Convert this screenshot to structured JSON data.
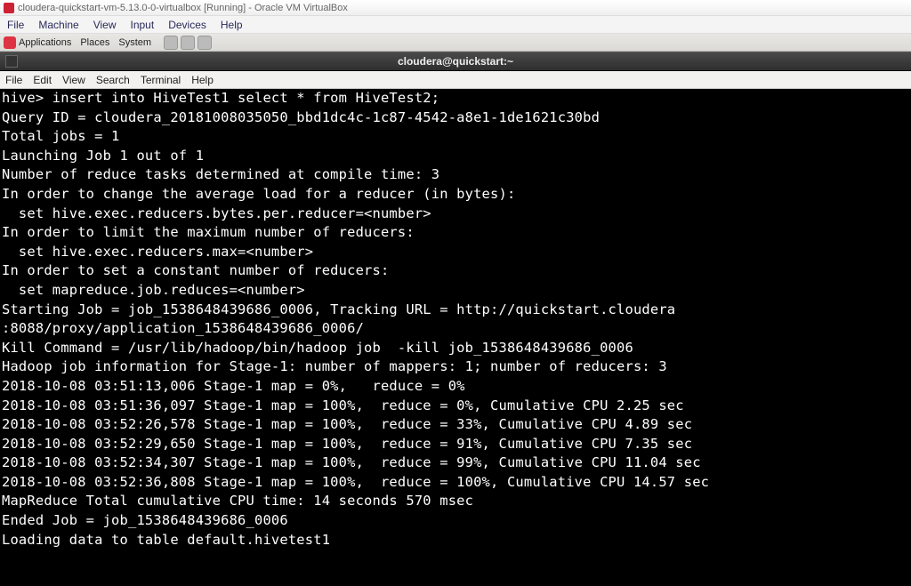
{
  "vbox": {
    "title": "cloudera-quickstart-vm-5.13.0-0-virtualbox [Running] - Oracle VM VirtualBox",
    "menu": [
      "File",
      "Machine",
      "View",
      "Input",
      "Devices",
      "Help"
    ]
  },
  "gnome": {
    "applications": "Applications",
    "places": "Places",
    "system": "System"
  },
  "terminal": {
    "title": "cloudera@quickstart:~",
    "menu": [
      "File",
      "Edit",
      "View",
      "Search",
      "Terminal",
      "Help"
    ],
    "lines": [
      "hive> insert into HiveTest1 select * from HiveTest2;",
      "Query ID = cloudera_20181008035050_bbd1dc4c-1c87-4542-a8e1-1de1621c30bd",
      "Total jobs = 1",
      "Launching Job 1 out of 1",
      "Number of reduce tasks determined at compile time: 3",
      "In order to change the average load for a reducer (in bytes):",
      "  set hive.exec.reducers.bytes.per.reducer=<number>",
      "In order to limit the maximum number of reducers:",
      "  set hive.exec.reducers.max=<number>",
      "In order to set a constant number of reducers:",
      "  set mapreduce.job.reduces=<number>",
      "Starting Job = job_1538648439686_0006, Tracking URL = http://quickstart.cloudera",
      ":8088/proxy/application_1538648439686_0006/",
      "Kill Command = /usr/lib/hadoop/bin/hadoop job  -kill job_1538648439686_0006",
      "Hadoop job information for Stage-1: number of mappers: 1; number of reducers: 3",
      "2018-10-08 03:51:13,006 Stage-1 map = 0%,   reduce = 0%",
      "2018-10-08 03:51:36,097 Stage-1 map = 100%,  reduce = 0%, Cumulative CPU 2.25 sec",
      "2018-10-08 03:52:26,578 Stage-1 map = 100%,  reduce = 33%, Cumulative CPU 4.89 sec",
      "2018-10-08 03:52:29,650 Stage-1 map = 100%,  reduce = 91%, Cumulative CPU 7.35 sec",
      "2018-10-08 03:52:34,307 Stage-1 map = 100%,  reduce = 99%, Cumulative CPU 11.04 sec",
      "2018-10-08 03:52:36,808 Stage-1 map = 100%,  reduce = 100%, Cumulative CPU 14.57 sec",
      "MapReduce Total cumulative CPU time: 14 seconds 570 msec",
      "Ended Job = job_1538648439686_0006",
      "Loading data to table default.hivetest1"
    ]
  }
}
